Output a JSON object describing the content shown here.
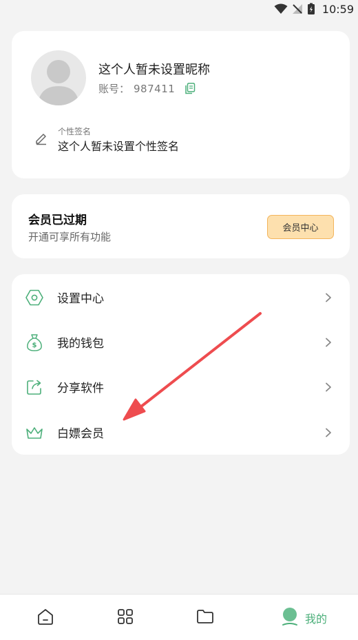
{
  "status_bar": {
    "time": "10:59"
  },
  "profile": {
    "nickname": "这个人暂未设置昵称",
    "account_label": "账号：",
    "account_number": "987411",
    "signature_caption": "个性签名",
    "signature_text": "这个人暂未设置个性签名"
  },
  "vip": {
    "title": "会员已过期",
    "subtitle": "开通可享所有功能",
    "button_label": "会员中心"
  },
  "menu": [
    {
      "label": "设置中心",
      "icon": "settings-hexagon-icon"
    },
    {
      "label": "我的钱包",
      "icon": "money-bag-icon"
    },
    {
      "label": "分享软件",
      "icon": "share-icon"
    },
    {
      "label": "白嫖会员",
      "icon": "crown-icon"
    }
  ],
  "bottom_nav": {
    "items": [
      {
        "icon": "home-icon",
        "label": ""
      },
      {
        "icon": "apps-grid-icon",
        "label": ""
      },
      {
        "icon": "folder-icon",
        "label": ""
      },
      {
        "icon": "user-icon",
        "label": "我的",
        "active": true
      }
    ]
  },
  "colors": {
    "accent_green": "#4caf7a",
    "vip_button_bg": "#fde0ae",
    "vip_button_border": "#f3b45b",
    "annotation_red": "#ee4c4f",
    "background": "#f3f3f3"
  }
}
